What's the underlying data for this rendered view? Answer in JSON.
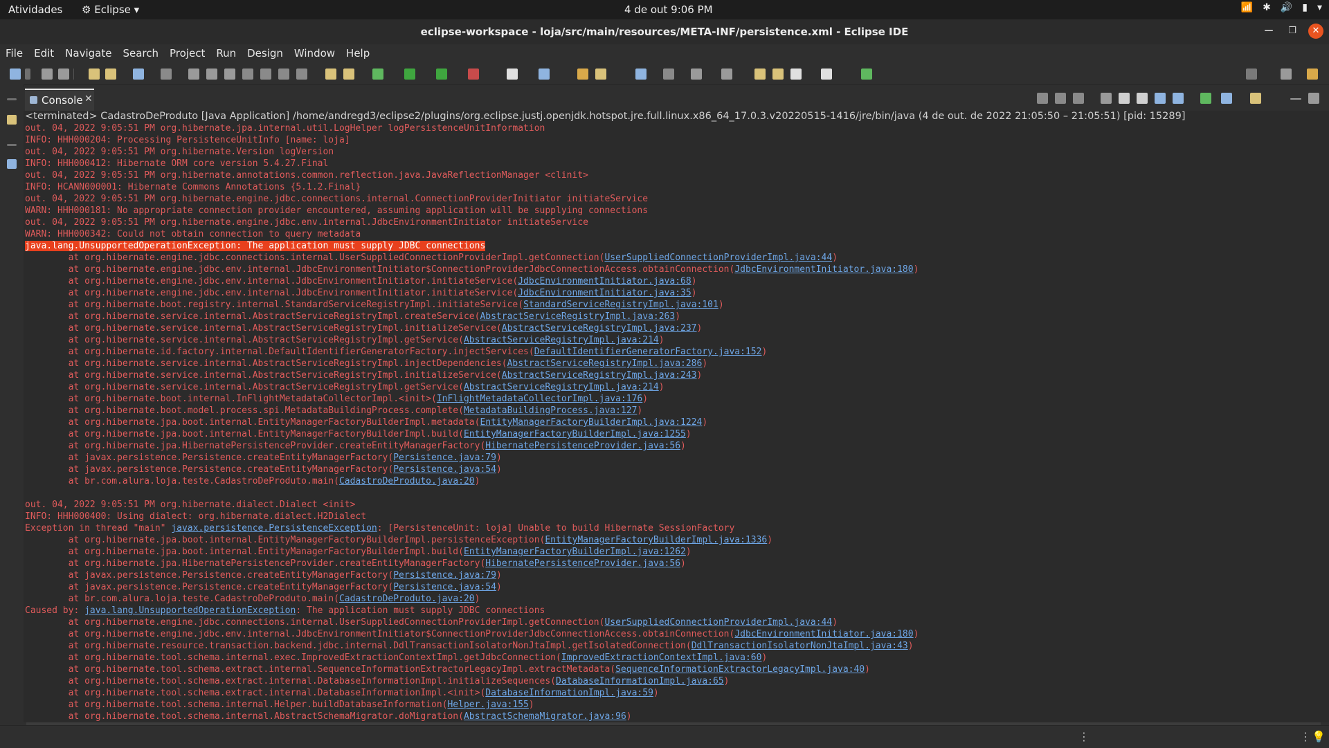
{
  "topbar": {
    "activities": "Atividades",
    "app": "Eclipse",
    "clock": "4 de out  9:06 PM"
  },
  "window": {
    "title": "eclipse-workspace - loja/src/main/resources/META-INF/persistence.xml - Eclipse IDE"
  },
  "menu": [
    "File",
    "Edit",
    "Navigate",
    "Search",
    "Project",
    "Run",
    "Design",
    "Window",
    "Help"
  ],
  "console": {
    "tab_label": "Console",
    "header": "<terminated> CadastroDeProduto [Java Application] /home/andregd3/eclipse2/plugins/org.eclipse.justj.openjdk.hotspot.jre.full.linux.x86_64_17.0.3.v20220515-1416/jre/bin/java  (4 de out. de 2022 21:05:50 – 21:05:51) [pid: 15289]",
    "lines": [
      {
        "t": "out. 04, 2022 9:05:51 PM org.hibernate.jpa.internal.util.LogHelper logPersistenceUnitInformation"
      },
      {
        "t": "INFO: HHH000204: Processing PersistenceUnitInfo [name: loja]"
      },
      {
        "t": "out. 04, 2022 9:05:51 PM org.hibernate.Version logVersion"
      },
      {
        "t": "INFO: HHH000412: Hibernate ORM core version 5.4.27.Final"
      },
      {
        "t": "out. 04, 2022 9:05:51 PM org.hibernate.annotations.common.reflection.java.JavaReflectionManager <clinit>"
      },
      {
        "t": "INFO: HCANN000001: Hibernate Commons Annotations {5.1.2.Final}"
      },
      {
        "t": "out. 04, 2022 9:05:51 PM org.hibernate.engine.jdbc.connections.internal.ConnectionProviderInitiator initiateService"
      },
      {
        "t": "WARN: HHH000181: No appropriate connection provider encountered, assuming application will be supplying connections"
      },
      {
        "t": "out. 04, 2022 9:05:51 PM org.hibernate.engine.jdbc.env.internal.JdbcEnvironmentInitiator initiateService"
      },
      {
        "t": "WARN: HHH000342: Could not obtain connection to query metadata"
      },
      {
        "h": "java.lang.UnsupportedOperationException: The application must supply JDBC connections"
      },
      {
        "t": "\tat org.hibernate.engine.jdbc.connections.internal.UserSuppliedConnectionProviderImpl.getConnection(",
        "l": "UserSuppliedConnectionProviderImpl.java:44",
        "a": ")"
      },
      {
        "t": "\tat org.hibernate.engine.jdbc.env.internal.JdbcEnvironmentInitiator$ConnectionProviderJdbcConnectionAccess.obtainConnection(",
        "l": "JdbcEnvironmentInitiator.java:180",
        "a": ")"
      },
      {
        "t": "\tat org.hibernate.engine.jdbc.env.internal.JdbcEnvironmentInitiator.initiateService(",
        "l": "JdbcEnvironmentInitiator.java:68",
        "a": ")"
      },
      {
        "t": "\tat org.hibernate.engine.jdbc.env.internal.JdbcEnvironmentInitiator.initiateService(",
        "l": "JdbcEnvironmentInitiator.java:35",
        "a": ")"
      },
      {
        "t": "\tat org.hibernate.boot.registry.internal.StandardServiceRegistryImpl.initiateService(",
        "l": "StandardServiceRegistryImpl.java:101",
        "a": ")"
      },
      {
        "t": "\tat org.hibernate.service.internal.AbstractServiceRegistryImpl.createService(",
        "l": "AbstractServiceRegistryImpl.java:263",
        "a": ")"
      },
      {
        "t": "\tat org.hibernate.service.internal.AbstractServiceRegistryImpl.initializeService(",
        "l": "AbstractServiceRegistryImpl.java:237",
        "a": ")"
      },
      {
        "t": "\tat org.hibernate.service.internal.AbstractServiceRegistryImpl.getService(",
        "l": "AbstractServiceRegistryImpl.java:214",
        "a": ")"
      },
      {
        "t": "\tat org.hibernate.id.factory.internal.DefaultIdentifierGeneratorFactory.injectServices(",
        "l": "DefaultIdentifierGeneratorFactory.java:152",
        "a": ")"
      },
      {
        "t": "\tat org.hibernate.service.internal.AbstractServiceRegistryImpl.injectDependencies(",
        "l": "AbstractServiceRegistryImpl.java:286",
        "a": ")"
      },
      {
        "t": "\tat org.hibernate.service.internal.AbstractServiceRegistryImpl.initializeService(",
        "l": "AbstractServiceRegistryImpl.java:243",
        "a": ")"
      },
      {
        "t": "\tat org.hibernate.service.internal.AbstractServiceRegistryImpl.getService(",
        "l": "AbstractServiceRegistryImpl.java:214",
        "a": ")"
      },
      {
        "t": "\tat org.hibernate.boot.internal.InFlightMetadataCollectorImpl.<init>(",
        "l": "InFlightMetadataCollectorImpl.java:176",
        "a": ")"
      },
      {
        "t": "\tat org.hibernate.boot.model.process.spi.MetadataBuildingProcess.complete(",
        "l": "MetadataBuildingProcess.java:127",
        "a": ")"
      },
      {
        "t": "\tat org.hibernate.jpa.boot.internal.EntityManagerFactoryBuilderImpl.metadata(",
        "l": "EntityManagerFactoryBuilderImpl.java:1224",
        "a": ")"
      },
      {
        "t": "\tat org.hibernate.jpa.boot.internal.EntityManagerFactoryBuilderImpl.build(",
        "l": "EntityManagerFactoryBuilderImpl.java:1255",
        "a": ")"
      },
      {
        "t": "\tat org.hibernate.jpa.HibernatePersistenceProvider.createEntityManagerFactory(",
        "l": "HibernatePersistenceProvider.java:56",
        "a": ")"
      },
      {
        "t": "\tat javax.persistence.Persistence.createEntityManagerFactory(",
        "l": "Persistence.java:79",
        "a": ")"
      },
      {
        "t": "\tat javax.persistence.Persistence.createEntityManagerFactory(",
        "l": "Persistence.java:54",
        "a": ")"
      },
      {
        "t": "\tat br.com.alura.loja.teste.CadastroDeProduto.main(",
        "l": "CadastroDeProduto.java:20",
        "a": ")"
      },
      {
        "t": ""
      },
      {
        "t": "out. 04, 2022 9:05:51 PM org.hibernate.dialect.Dialect <init>"
      },
      {
        "t": "INFO: HHH000400: Using dialect: org.hibernate.dialect.H2Dialect"
      },
      {
        "t": "Exception in thread \"main\" ",
        "l": "javax.persistence.PersistenceException",
        "a": ": [PersistenceUnit: loja] Unable to build Hibernate SessionFactory"
      },
      {
        "t": "\tat org.hibernate.jpa.boot.internal.EntityManagerFactoryBuilderImpl.persistenceException(",
        "l": "EntityManagerFactoryBuilderImpl.java:1336",
        "a": ")"
      },
      {
        "t": "\tat org.hibernate.jpa.boot.internal.EntityManagerFactoryBuilderImpl.build(",
        "l": "EntityManagerFactoryBuilderImpl.java:1262",
        "a": ")"
      },
      {
        "t": "\tat org.hibernate.jpa.HibernatePersistenceProvider.createEntityManagerFactory(",
        "l": "HibernatePersistenceProvider.java:56",
        "a": ")"
      },
      {
        "t": "\tat javax.persistence.Persistence.createEntityManagerFactory(",
        "l": "Persistence.java:79",
        "a": ")"
      },
      {
        "t": "\tat javax.persistence.Persistence.createEntityManagerFactory(",
        "l": "Persistence.java:54",
        "a": ")"
      },
      {
        "t": "\tat br.com.alura.loja.teste.CadastroDeProduto.main(",
        "l": "CadastroDeProduto.java:20",
        "a": ")"
      },
      {
        "t": "Caused by: ",
        "l": "java.lang.UnsupportedOperationException",
        "a": ": The application must supply JDBC connections"
      },
      {
        "t": "\tat org.hibernate.engine.jdbc.connections.internal.UserSuppliedConnectionProviderImpl.getConnection(",
        "l": "UserSuppliedConnectionProviderImpl.java:44",
        "a": ")"
      },
      {
        "t": "\tat org.hibernate.engine.jdbc.env.internal.JdbcEnvironmentInitiator$ConnectionProviderJdbcConnectionAccess.obtainConnection(",
        "l": "JdbcEnvironmentInitiator.java:180",
        "a": ")"
      },
      {
        "t": "\tat org.hibernate.resource.transaction.backend.jdbc.internal.DdlTransactionIsolatorNonJtaImpl.getIsolatedConnection(",
        "l": "DdlTransactionIsolatorNonJtaImpl.java:43",
        "a": ")"
      },
      {
        "t": "\tat org.hibernate.tool.schema.internal.exec.ImprovedExtractionContextImpl.getJdbcConnection(",
        "l": "ImprovedExtractionContextImpl.java:60",
        "a": ")"
      },
      {
        "t": "\tat org.hibernate.tool.schema.extract.internal.SequenceInformationExtractorLegacyImpl.extractMetadata(",
        "l": "SequenceInformationExtractorLegacyImpl.java:40",
        "a": ")"
      },
      {
        "t": "\tat org.hibernate.tool.schema.extract.internal.DatabaseInformationImpl.initializeSequences(",
        "l": "DatabaseInformationImpl.java:65",
        "a": ")"
      },
      {
        "t": "\tat org.hibernate.tool.schema.extract.internal.DatabaseInformationImpl.<init>(",
        "l": "DatabaseInformationImpl.java:59",
        "a": ")"
      },
      {
        "t": "\tat org.hibernate.tool.schema.internal.Helper.buildDatabaseInformation(",
        "l": "Helper.java:155",
        "a": ")"
      },
      {
        "t": "\tat org.hibernate.tool.schema.internal.AbstractSchemaMigrator.doMigration(",
        "l": "AbstractSchemaMigrator.java:96",
        "a": ")"
      }
    ]
  },
  "colors": {
    "console_bg": "#2b2b2b",
    "stderr_text": "#e05b5b",
    "link": "#6ea6e6",
    "highlight": "#e8401d",
    "close_button": "#e95420"
  }
}
